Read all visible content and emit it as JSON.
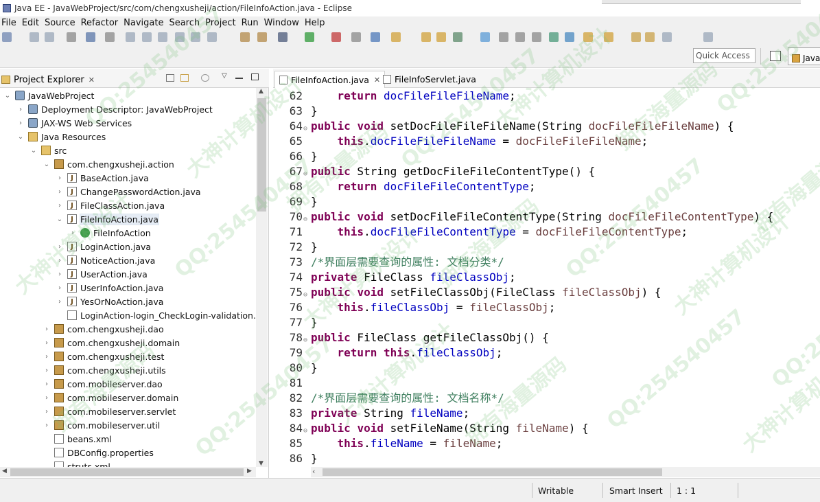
{
  "window": {
    "title": "Java EE - JavaWebProject/src/com/chengxusheji/action/FileInfoAction.java - Eclipse"
  },
  "menu": [
    "File",
    "Edit",
    "Source",
    "Refactor",
    "Navigate",
    "Search",
    "Project",
    "Run",
    "Window",
    "Help"
  ],
  "quick_access": {
    "placeholder": "Quick Access"
  },
  "perspective": {
    "label": "Java"
  },
  "explorer": {
    "title": "Project Explorer",
    "tree": [
      {
        "label": "JavaWebProject",
        "depth": 0,
        "icon": "project-icon",
        "twisty": "open"
      },
      {
        "label": "Deployment Descriptor: JavaWebProject",
        "depth": 1,
        "icon": "descriptor-icon",
        "twisty": "closed"
      },
      {
        "label": "JAX-WS Web Services",
        "depth": 1,
        "icon": "webservice-icon",
        "twisty": "closed"
      },
      {
        "label": "Java Resources",
        "depth": 1,
        "icon": "folder-icon",
        "twisty": "open"
      },
      {
        "label": "src",
        "depth": 2,
        "icon": "folder-icon",
        "twisty": "open"
      },
      {
        "label": "com.chengxusheji.action",
        "depth": 3,
        "icon": "package-icon",
        "twisty": "open"
      },
      {
        "label": "BaseAction.java",
        "depth": 4,
        "icon": "java-file-icon",
        "twisty": "closed"
      },
      {
        "label": "ChangePasswordAction.java",
        "depth": 4,
        "icon": "java-file-icon",
        "twisty": "closed"
      },
      {
        "label": "FileClassAction.java",
        "depth": 4,
        "icon": "java-file-icon",
        "twisty": "closed"
      },
      {
        "label": "FileInfoAction.java",
        "depth": 4,
        "icon": "java-file-icon",
        "twisty": "open",
        "selected": true
      },
      {
        "label": "FileInfoAction",
        "depth": 5,
        "icon": "class-icon",
        "twisty": "closed"
      },
      {
        "label": "LoginAction.java",
        "depth": 4,
        "icon": "java-file-icon",
        "twisty": "closed"
      },
      {
        "label": "NoticeAction.java",
        "depth": 4,
        "icon": "java-file-icon",
        "twisty": "closed"
      },
      {
        "label": "UserAction.java",
        "depth": 4,
        "icon": "java-file-icon",
        "twisty": "closed"
      },
      {
        "label": "UserInfoAction.java",
        "depth": 4,
        "icon": "java-file-icon",
        "twisty": "closed"
      },
      {
        "label": "YesOrNoAction.java",
        "depth": 4,
        "icon": "java-file-icon",
        "twisty": "closed"
      },
      {
        "label": "LoginAction-login_CheckLogin-validation.xm",
        "depth": 4,
        "icon": "xml-file-icon",
        "twisty": "none"
      },
      {
        "label": "com.chengxusheji.dao",
        "depth": 3,
        "icon": "package-icon",
        "twisty": "closed"
      },
      {
        "label": "com.chengxusheji.domain",
        "depth": 3,
        "icon": "package-icon",
        "twisty": "closed"
      },
      {
        "label": "com.chengxusheji.test",
        "depth": 3,
        "icon": "package-icon",
        "twisty": "closed"
      },
      {
        "label": "com.chengxusheji.utils",
        "depth": 3,
        "icon": "package-icon",
        "twisty": "closed"
      },
      {
        "label": "com.mobileserver.dao",
        "depth": 3,
        "icon": "package-icon",
        "twisty": "closed"
      },
      {
        "label": "com.mobileserver.domain",
        "depth": 3,
        "icon": "package-icon",
        "twisty": "closed"
      },
      {
        "label": "com.mobileserver.servlet",
        "depth": 3,
        "icon": "package-icon",
        "twisty": "closed"
      },
      {
        "label": "com.mobileserver.util",
        "depth": 3,
        "icon": "package-icon",
        "twisty": "closed"
      },
      {
        "label": "beans.xml",
        "depth": 3,
        "icon": "xml-file-icon",
        "twisty": "none"
      },
      {
        "label": "DBConfig.properties",
        "depth": 3,
        "icon": "properties-file-icon",
        "twisty": "none"
      },
      {
        "label": "struts.xml",
        "depth": 3,
        "icon": "xml-file-icon",
        "twisty": "none"
      }
    ]
  },
  "editor": {
    "tabs": [
      {
        "label": "FileInfoAction.java",
        "active": true,
        "closable": true
      },
      {
        "label": "FileInfoServlet.java",
        "active": false,
        "closable": false
      }
    ],
    "lines": [
      {
        "n": "62",
        "fold": "",
        "tokens": [
          [
            "ind",
            "    "
          ],
          [
            "kw",
            "return"
          ],
          [
            "t",
            " "
          ],
          [
            "fld",
            "docFileFileFileName"
          ],
          [
            "t",
            ";"
          ]
        ]
      },
      {
        "n": "63",
        "fold": "",
        "tokens": [
          [
            "t",
            "}"
          ]
        ]
      },
      {
        "n": "64",
        "fold": "⊖",
        "tokens": [
          [
            "kw",
            "public"
          ],
          [
            "t",
            " "
          ],
          [
            "kw",
            "void"
          ],
          [
            "t",
            " setDocFileFileFileName(String "
          ],
          [
            "prm",
            "docFileFileFileName"
          ],
          [
            "t",
            ") {"
          ]
        ]
      },
      {
        "n": "65",
        "fold": "",
        "tokens": [
          [
            "ind",
            "    "
          ],
          [
            "kw",
            "this"
          ],
          [
            "t",
            "."
          ],
          [
            "fld",
            "docFileFileFileName"
          ],
          [
            "t",
            " = "
          ],
          [
            "prm",
            "docFileFileFileName"
          ],
          [
            "t",
            ";"
          ]
        ]
      },
      {
        "n": "66",
        "fold": "",
        "tokens": [
          [
            "t",
            "}"
          ]
        ]
      },
      {
        "n": "67",
        "fold": "⊖",
        "tokens": [
          [
            "kw",
            "public"
          ],
          [
            "t",
            " String getDocFileFileContentType() {"
          ]
        ]
      },
      {
        "n": "68",
        "fold": "",
        "tokens": [
          [
            "ind",
            "    "
          ],
          [
            "kw",
            "return"
          ],
          [
            "t",
            " "
          ],
          [
            "fld",
            "docFileFileContentType"
          ],
          [
            "t",
            ";"
          ]
        ]
      },
      {
        "n": "69",
        "fold": "",
        "tokens": [
          [
            "t",
            "}"
          ]
        ]
      },
      {
        "n": "70",
        "fold": "⊖",
        "tokens": [
          [
            "kw",
            "public"
          ],
          [
            "t",
            " "
          ],
          [
            "kw",
            "void"
          ],
          [
            "t",
            " setDocFileFileContentType(String "
          ],
          [
            "prm",
            "docFileFileContentType"
          ],
          [
            "t",
            ") {"
          ]
        ]
      },
      {
        "n": "71",
        "fold": "",
        "tokens": [
          [
            "ind",
            "    "
          ],
          [
            "kw",
            "this"
          ],
          [
            "t",
            "."
          ],
          [
            "fld",
            "docFileFileContentType"
          ],
          [
            "t",
            " = "
          ],
          [
            "prm",
            "docFileFileContentType"
          ],
          [
            "t",
            ";"
          ]
        ]
      },
      {
        "n": "72",
        "fold": "",
        "tokens": [
          [
            "t",
            "}"
          ]
        ]
      },
      {
        "n": "73",
        "fold": "",
        "tokens": [
          [
            "cmt",
            "/*界面层需要查询的属性: 文档分类*/"
          ]
        ]
      },
      {
        "n": "74",
        "fold": "",
        "tokens": [
          [
            "kw",
            "private"
          ],
          [
            "t",
            " FileClass "
          ],
          [
            "fld",
            "fileClassObj"
          ],
          [
            "t",
            ";"
          ]
        ]
      },
      {
        "n": "75",
        "fold": "⊖",
        "tokens": [
          [
            "kw",
            "public"
          ],
          [
            "t",
            " "
          ],
          [
            "kw",
            "void"
          ],
          [
            "t",
            " setFileClassObj(FileClass "
          ],
          [
            "prm",
            "fileClassObj"
          ],
          [
            "t",
            ") {"
          ]
        ]
      },
      {
        "n": "76",
        "fold": "",
        "tokens": [
          [
            "ind",
            "    "
          ],
          [
            "kw",
            "this"
          ],
          [
            "t",
            "."
          ],
          [
            "fld",
            "fileClassObj"
          ],
          [
            "t",
            " = "
          ],
          [
            "prm",
            "fileClassObj"
          ],
          [
            "t",
            ";"
          ]
        ]
      },
      {
        "n": "77",
        "fold": "",
        "tokens": [
          [
            "t",
            "}"
          ]
        ]
      },
      {
        "n": "78",
        "fold": "⊖",
        "tokens": [
          [
            "kw",
            "public"
          ],
          [
            "t",
            " FileClass getFileClassObj() {"
          ]
        ]
      },
      {
        "n": "79",
        "fold": "",
        "tokens": [
          [
            "ind",
            "    "
          ],
          [
            "kw",
            "return"
          ],
          [
            "t",
            " "
          ],
          [
            "kw",
            "this"
          ],
          [
            "t",
            "."
          ],
          [
            "fld",
            "fileClassObj"
          ],
          [
            "t",
            ";"
          ]
        ]
      },
      {
        "n": "80",
        "fold": "",
        "tokens": [
          [
            "t",
            "}"
          ]
        ]
      },
      {
        "n": "81",
        "fold": "",
        "tokens": []
      },
      {
        "n": "82",
        "fold": "",
        "tokens": [
          [
            "cmt",
            "/*界面层需要查询的属性: 文档名称*/"
          ]
        ]
      },
      {
        "n": "83",
        "fold": "",
        "tokens": [
          [
            "kw",
            "private"
          ],
          [
            "t",
            " String "
          ],
          [
            "fld",
            "fileName"
          ],
          [
            "t",
            ";"
          ]
        ]
      },
      {
        "n": "84",
        "fold": "⊖",
        "tokens": [
          [
            "kw",
            "public"
          ],
          [
            "t",
            " "
          ],
          [
            "kw",
            "void"
          ],
          [
            "t",
            " setFileName(String "
          ],
          [
            "prm",
            "fileName"
          ],
          [
            "t",
            ") {"
          ]
        ]
      },
      {
        "n": "85",
        "fold": "",
        "tokens": [
          [
            "ind",
            "    "
          ],
          [
            "kw",
            "this"
          ],
          [
            "t",
            "."
          ],
          [
            "fld",
            "fileName"
          ],
          [
            "t",
            " = "
          ],
          [
            "prm",
            "fileName"
          ],
          [
            "t",
            ";"
          ]
        ]
      },
      {
        "n": "86",
        "fold": "",
        "tokens": [
          [
            "t",
            "}"
          ]
        ]
      }
    ]
  },
  "status": {
    "mode": "Writable",
    "insert": "Smart Insert",
    "position": "1 : 1"
  },
  "watermarks": [
    "QQ:254540457",
    "大神计算机设计",
    "拥有海量源码"
  ]
}
